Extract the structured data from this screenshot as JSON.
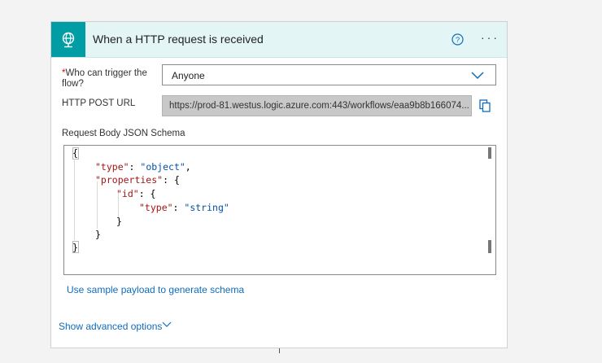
{
  "trigger": {
    "title": "When a HTTP request is received",
    "icon": "globe-request-icon",
    "accent_color": "#009da5",
    "header_bg": "#e4f5f6"
  },
  "who_can_trigger": {
    "label_line1": "Who can trigger the",
    "label_line2": "flow?",
    "required_marker": "*",
    "value": "Anyone"
  },
  "http_post_url": {
    "label": "HTTP POST URL",
    "value": "https://prod-81.westus.logic.azure.com:443/workflows/eaa9b8b166074..."
  },
  "schema": {
    "label": "Request Body JSON Schema",
    "lines": {
      "l1": "{",
      "l2_key": "\"type\"",
      "l2_sep": ": ",
      "l2_val": "\"object\"",
      "l2_end": ",",
      "l3_key": "\"properties\"",
      "l3_end": ": {",
      "l4_key": "\"id\"",
      "l4_end": ": {",
      "l5_key": "\"type\"",
      "l5_sep": ": ",
      "l5_val": "\"string\"",
      "l6": "}",
      "l7": "}",
      "l8": "}"
    }
  },
  "links": {
    "sample_payload": "Use sample payload to generate schema",
    "advanced": "Show advanced options"
  }
}
